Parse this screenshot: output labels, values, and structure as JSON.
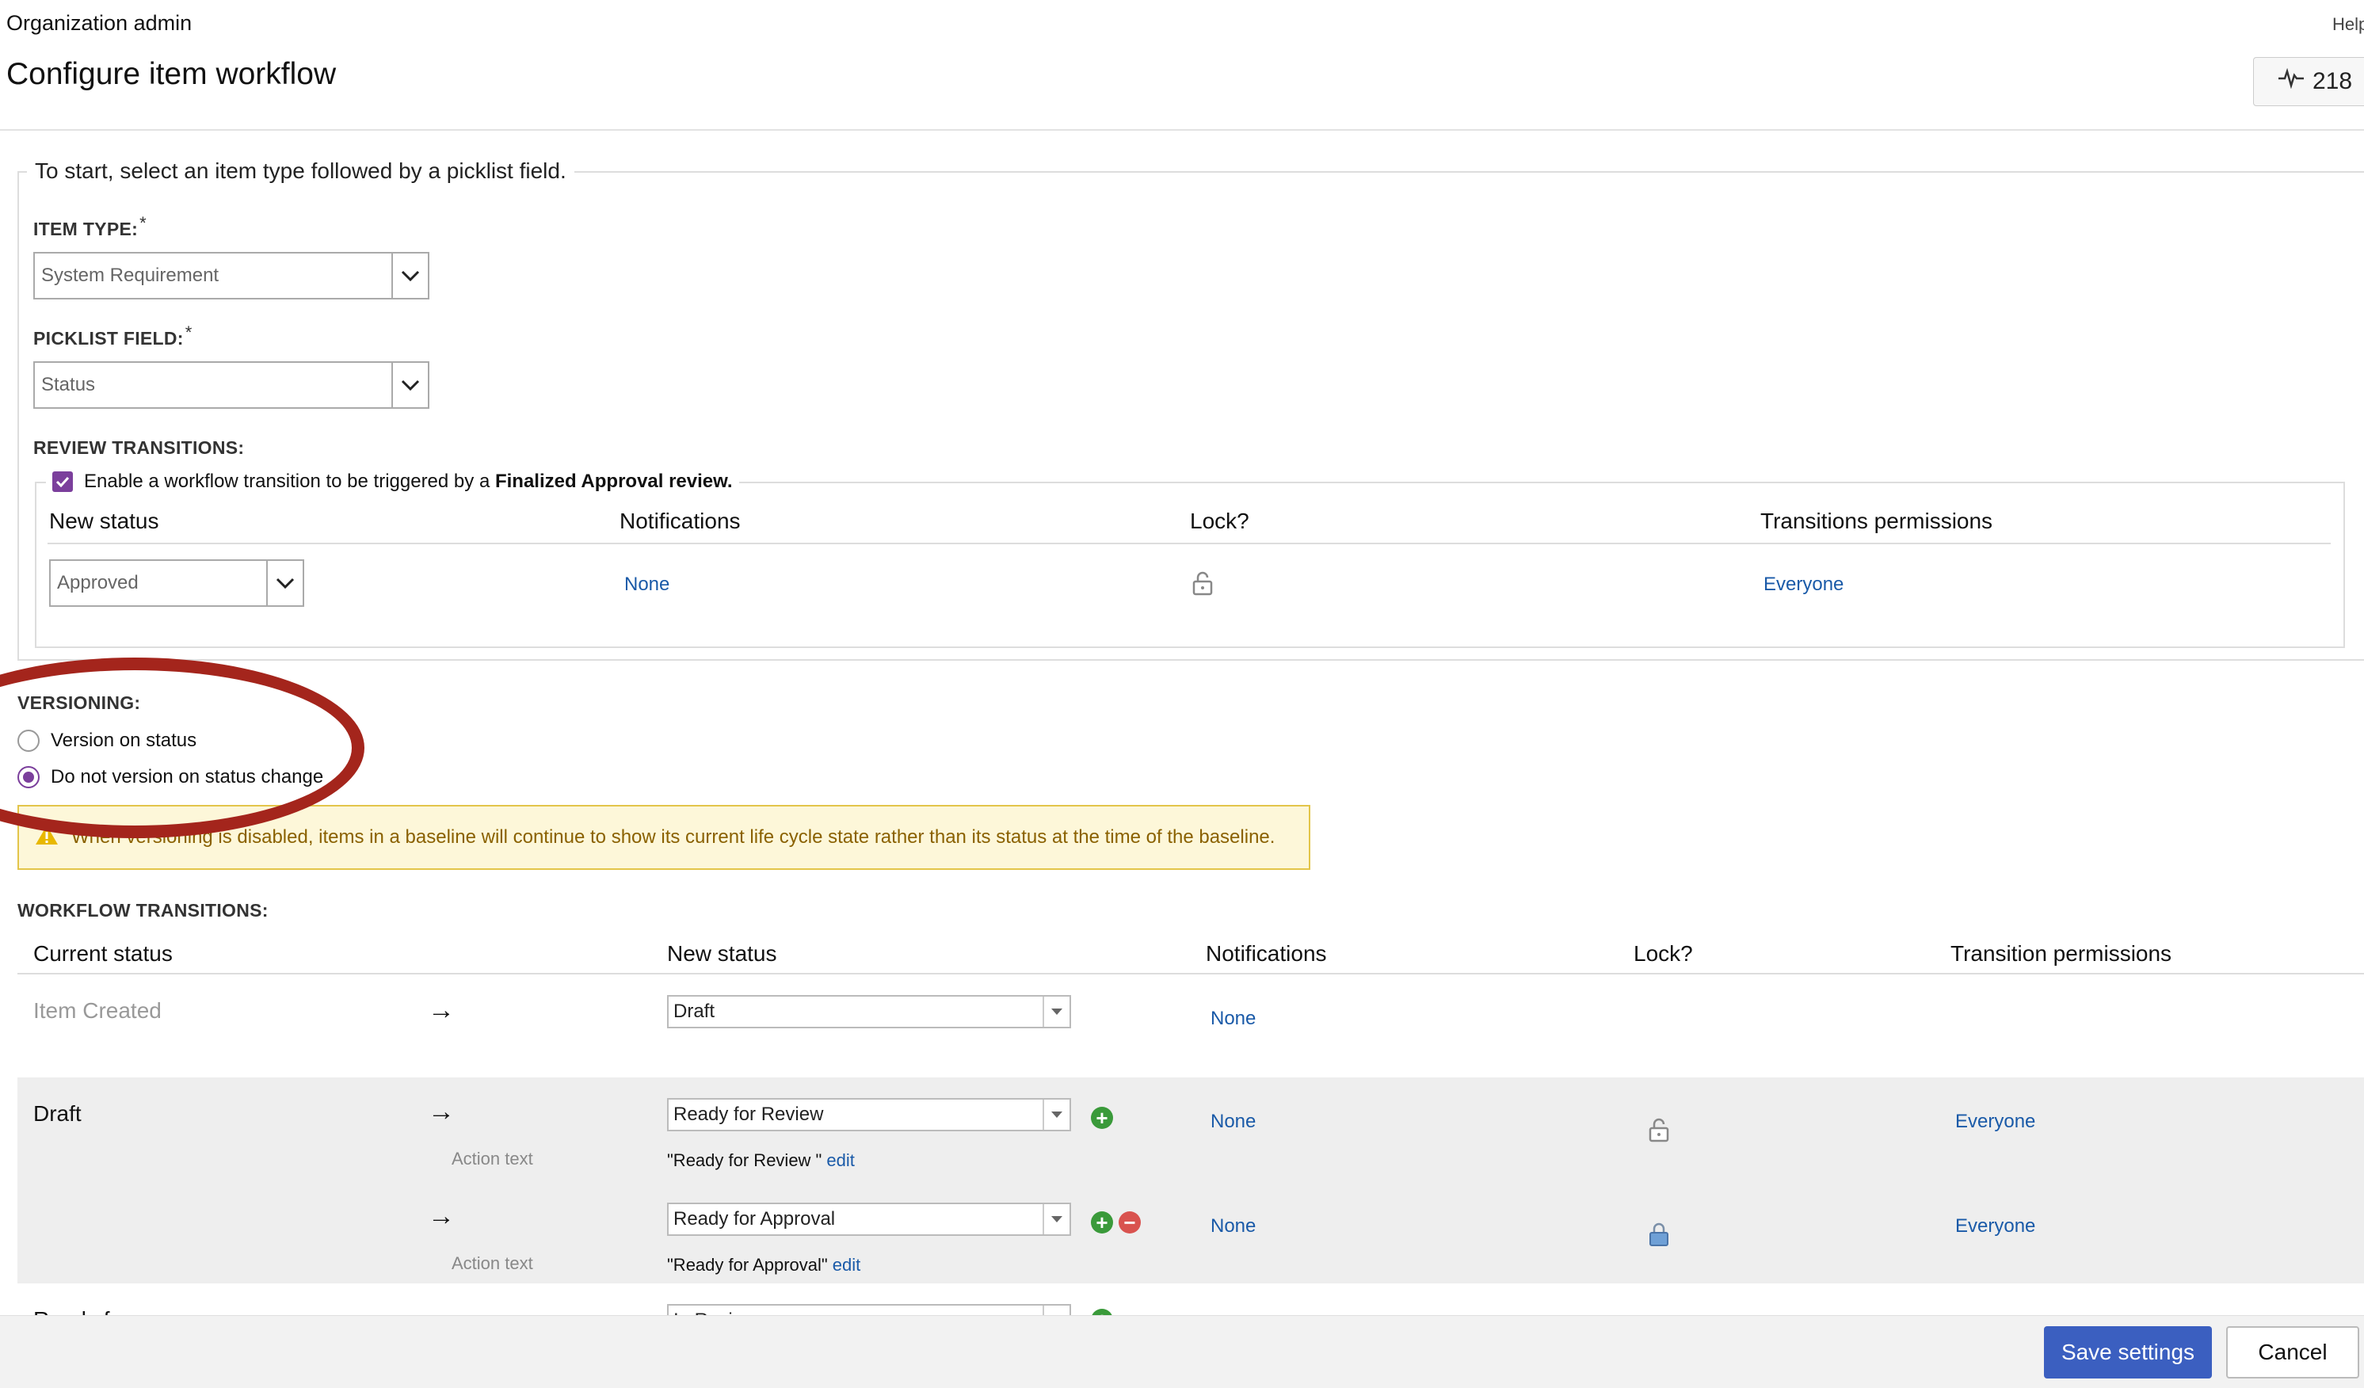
{
  "header": {
    "breadcrumb": "Organization admin",
    "help": "Help",
    "title": "Configure item workflow",
    "activity_count": "218"
  },
  "setup": {
    "legend": "To start, select an item type followed by a picklist field.",
    "item_type_label": "ITEM TYPE:",
    "item_type_value": "System Requirement",
    "picklist_label": "PICKLIST FIELD:",
    "picklist_value": "Status",
    "required_mark": "*"
  },
  "review": {
    "label": "REVIEW TRANSITIONS:",
    "checkbox_text": "Enable a workflow transition to be triggered by a ",
    "checkbox_bold": "Finalized Approval review.",
    "checked": true,
    "columns": [
      "New status",
      "Notifications",
      "Lock?",
      "Transitions permissions"
    ],
    "new_status": "Approved",
    "notifications": "None",
    "permissions": "Everyone"
  },
  "versioning": {
    "label": "VERSIONING:",
    "options": [
      "Version on status",
      "Do not version on status change"
    ],
    "selected_index": 1,
    "warning": "When versioning is disabled, items in a baseline will continue to show its current life cycle state rather than its status at the time of the baseline."
  },
  "workflow": {
    "label": "WORKFLOW TRANSITIONS:",
    "columns": [
      "Current status",
      "New status",
      "Notifications",
      "Lock?",
      "Transition permissions"
    ],
    "arrow": "→",
    "action_label": "Action text",
    "edit_label": "edit",
    "rows": [
      {
        "current": "Item Created",
        "new_status": "Draft",
        "notifications": "None"
      },
      {
        "current": "Draft",
        "new_status": "Ready for Review",
        "notifications": "None",
        "permissions": "Everyone",
        "action_text": "\"Ready for Review \""
      },
      {
        "current": "",
        "new_status": "Ready for Approval",
        "notifications": "None",
        "permissions": "Everyone",
        "action_text": "\"Ready for Approval\""
      }
    ],
    "partial_row": {
      "current": "Ready for",
      "new_status": "In Review"
    }
  },
  "footer": {
    "save": "Save settings",
    "cancel": "Cancel"
  },
  "colors": {
    "accent_purple": "#7b3f9c",
    "link_blue": "#1a5aa8",
    "primary_button": "#3b5fc0",
    "highlight_red": "#a4251c",
    "warning_bg": "#fdf7d9"
  }
}
